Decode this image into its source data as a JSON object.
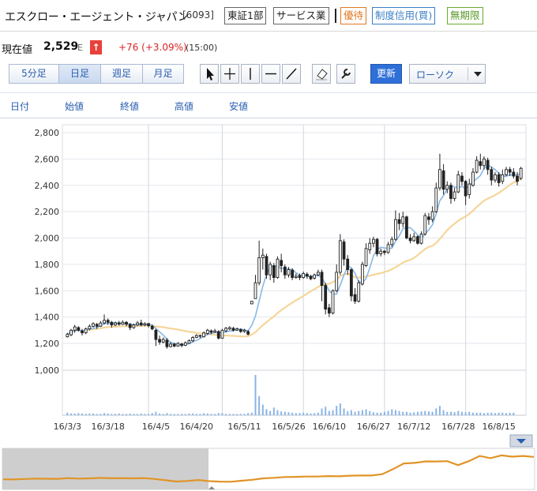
{
  "header": {
    "company_name": "エスクロー・エージェント・ジャパン",
    "code": "[6093]",
    "tags": {
      "market": "東証1部",
      "sector": "サービス業",
      "yutai": "優待",
      "seido": "制度信用(買)",
      "mukigen": "無期限"
    },
    "tag_colors": {
      "yutai": "#e07820",
      "seido": "#3a7fc8",
      "mukigen": "#5a9a2a"
    }
  },
  "quote": {
    "label": "現在値",
    "price": "2,529",
    "flag": "E",
    "arrow": "↑",
    "change": "+76 (+3.09%)",
    "time": "(15:00)",
    "change_color": "#d82424"
  },
  "toolbar": {
    "periods": [
      "5分足",
      "日足",
      "週足",
      "月足"
    ],
    "active_period": "日足",
    "tools": [
      "pointer-icon",
      "crosshair-icon",
      "vertical-line-icon",
      "horizontal-line-icon",
      "trend-line-icon",
      "eraser-icon",
      "wrench-icon"
    ],
    "update_label": "更新",
    "chart_type": "ローソク"
  },
  "ohlc_header": [
    "日付",
    "始値",
    "終値",
    "高値",
    "安値"
  ],
  "chart_data": {
    "type": "candlestick",
    "title": "",
    "ylim": [
      1000,
      2800
    ],
    "yticks": [
      "2,800",
      "2,600",
      "2,400",
      "2,200",
      "2,000",
      "1,800",
      "1,600",
      "1,400",
      "1,200",
      "1,000"
    ],
    "xticks": [
      "16/3/3",
      "16/3/18",
      "16/4/5",
      "16/4/20",
      "16/5/11",
      "16/5/26",
      "16/6/10",
      "16/6/27",
      "16/7/12",
      "16/7/28",
      "16/8/15"
    ],
    "grid": true,
    "volume_panel": true,
    "colors": {
      "ma_short": "#86b8e8",
      "ma_long": "#f5d69a",
      "volume": "#8ab4e6",
      "navigator_line": "#e09428"
    },
    "candles": [
      [
        1250,
        1270,
        1245,
        1280
      ],
      [
        1265,
        1300,
        1255,
        1310
      ],
      [
        1300,
        1325,
        1280,
        1340
      ],
      [
        1320,
        1300,
        1290,
        1330
      ],
      [
        1295,
        1280,
        1260,
        1310
      ],
      [
        1280,
        1310,
        1270,
        1320
      ],
      [
        1310,
        1330,
        1300,
        1345
      ],
      [
        1330,
        1350,
        1320,
        1360
      ],
      [
        1345,
        1330,
        1310,
        1355
      ],
      [
        1330,
        1355,
        1325,
        1370
      ],
      [
        1355,
        1375,
        1345,
        1420
      ],
      [
        1375,
        1360,
        1340,
        1390
      ],
      [
        1360,
        1340,
        1320,
        1370
      ],
      [
        1340,
        1355,
        1330,
        1365
      ],
      [
        1355,
        1345,
        1335,
        1370
      ],
      [
        1345,
        1360,
        1340,
        1375
      ],
      [
        1360,
        1345,
        1330,
        1370
      ],
      [
        1345,
        1320,
        1300,
        1355
      ],
      [
        1320,
        1340,
        1310,
        1350
      ],
      [
        1340,
        1355,
        1330,
        1370
      ],
      [
        1355,
        1340,
        1330,
        1380
      ],
      [
        1340,
        1350,
        1330,
        1360
      ],
      [
        1350,
        1335,
        1320,
        1355
      ],
      [
        1330,
        1310,
        1300,
        1345
      ],
      [
        1300,
        1230,
        1180,
        1310
      ],
      [
        1230,
        1210,
        1190,
        1260
      ],
      [
        1210,
        1230,
        1200,
        1245
      ],
      [
        1225,
        1175,
        1160,
        1240
      ],
      [
        1175,
        1195,
        1170,
        1210
      ],
      [
        1195,
        1180,
        1170,
        1205
      ],
      [
        1180,
        1200,
        1175,
        1210
      ],
      [
        1195,
        1185,
        1170,
        1205
      ],
      [
        1185,
        1205,
        1180,
        1215
      ],
      [
        1200,
        1220,
        1195,
        1230
      ],
      [
        1220,
        1245,
        1210,
        1255
      ],
      [
        1245,
        1260,
        1240,
        1270
      ],
      [
        1260,
        1255,
        1240,
        1265
      ],
      [
        1250,
        1280,
        1245,
        1290
      ],
      [
        1275,
        1300,
        1265,
        1310
      ],
      [
        1295,
        1285,
        1270,
        1305
      ],
      [
        1285,
        1295,
        1280,
        1310
      ],
      [
        1290,
        1240,
        1230,
        1300
      ],
      [
        1240,
        1300,
        1235,
        1310
      ],
      [
        1295,
        1315,
        1285,
        1325
      ],
      [
        1310,
        1320,
        1300,
        1330
      ],
      [
        1315,
        1300,
        1290,
        1325
      ],
      [
        1300,
        1310,
        1295,
        1320
      ],
      [
        1305,
        1290,
        1280,
        1315
      ],
      [
        1290,
        1300,
        1280,
        1310
      ],
      [
        1290,
        1270,
        1260,
        1300
      ],
      [
        1500,
        1520,
        1500,
        1520
      ],
      [
        1540,
        1660,
        1540,
        1720
      ],
      [
        1660,
        1850,
        1640,
        1980
      ],
      [
        1850,
        1870,
        1760,
        1920
      ],
      [
        1860,
        1720,
        1690,
        1880
      ],
      [
        1720,
        1800,
        1680,
        1820
      ],
      [
        1790,
        1700,
        1660,
        1810
      ],
      [
        1700,
        1840,
        1690,
        1860
      ],
      [
        1830,
        1790,
        1740,
        1880
      ],
      [
        1780,
        1720,
        1690,
        1800
      ],
      [
        1720,
        1760,
        1700,
        1780
      ],
      [
        1755,
        1700,
        1680,
        1770
      ],
      [
        1700,
        1710,
        1690,
        1730
      ],
      [
        1715,
        1700,
        1680,
        1730
      ],
      [
        1700,
        1730,
        1690,
        1745
      ],
      [
        1725,
        1710,
        1690,
        1740
      ],
      [
        1710,
        1690,
        1680,
        1720
      ],
      [
        1695,
        1720,
        1685,
        1730
      ],
      [
        1720,
        1740,
        1710,
        1760
      ],
      [
        1740,
        1640,
        1520,
        1760
      ],
      [
        1640,
        1460,
        1420,
        1660
      ],
      [
        1470,
        1430,
        1400,
        1500
      ],
      [
        1430,
        1600,
        1420,
        1610
      ],
      [
        1600,
        1740,
        1590,
        1800
      ],
      [
        1740,
        1980,
        1720,
        2030
      ],
      [
        1970,
        1840,
        1790,
        1990
      ],
      [
        1840,
        1760,
        1720,
        1870
      ],
      [
        1760,
        1560,
        1520,
        1770
      ],
      [
        1570,
        1520,
        1500,
        1620
      ],
      [
        1520,
        1660,
        1510,
        1680
      ],
      [
        1650,
        1800,
        1640,
        1820
      ],
      [
        1790,
        1920,
        1780,
        1960
      ],
      [
        1910,
        1960,
        1880,
        2000
      ],
      [
        1960,
        1990,
        1930,
        2010
      ],
      [
        1990,
        1880,
        1860,
        2000
      ],
      [
        1880,
        1900,
        1860,
        1920
      ],
      [
        1900,
        1890,
        1870,
        1910
      ],
      [
        1890,
        1950,
        1880,
        1970
      ],
      [
        1950,
        1990,
        1930,
        2010
      ],
      [
        1990,
        2140,
        1980,
        2210
      ],
      [
        2140,
        2110,
        2060,
        2190
      ],
      [
        2110,
        2160,
        2080,
        2200
      ],
      [
        2160,
        2000,
        1990,
        2170
      ],
      [
        2000,
        1980,
        1960,
        2030
      ],
      [
        1980,
        2010,
        1970,
        2040
      ],
      [
        2010,
        1960,
        1950,
        2020
      ],
      [
        1960,
        2030,
        1950,
        2050
      ],
      [
        2030,
        2170,
        2020,
        2190
      ],
      [
        2160,
        2140,
        2100,
        2190
      ],
      [
        2140,
        2200,
        2120,
        2240
      ],
      [
        2200,
        2380,
        2190,
        2420
      ],
      [
        2380,
        2520,
        2360,
        2640
      ],
      [
        2510,
        2370,
        2330,
        2560
      ],
      [
        2370,
        2400,
        2340,
        2430
      ],
      [
        2400,
        2300,
        2260,
        2420
      ],
      [
        2300,
        2350,
        2280,
        2380
      ],
      [
        2350,
        2480,
        2340,
        2510
      ],
      [
        2470,
        2430,
        2400,
        2500
      ],
      [
        2430,
        2320,
        2250,
        2440
      ],
      [
        2330,
        2410,
        2300,
        2450
      ],
      [
        2400,
        2500,
        2390,
        2530
      ],
      [
        2500,
        2590,
        2490,
        2620
      ],
      [
        2580,
        2550,
        2520,
        2640
      ],
      [
        2550,
        2600,
        2520,
        2620
      ],
      [
        2590,
        2520,
        2480,
        2610
      ],
      [
        2520,
        2440,
        2400,
        2540
      ],
      [
        2440,
        2480,
        2420,
        2500
      ],
      [
        2480,
        2420,
        2390,
        2500
      ],
      [
        2430,
        2480,
        2410,
        2520
      ],
      [
        2480,
        2520,
        2470,
        2540
      ],
      [
        2520,
        2500,
        2470,
        2540
      ],
      [
        2500,
        2470,
        2450,
        2530
      ],
      [
        2470,
        2430,
        2400,
        2500
      ],
      [
        2453,
        2529,
        2440,
        2540
      ]
    ],
    "volume": [
      6,
      4,
      4,
      5,
      4,
      3,
      4,
      4,
      3,
      3,
      5,
      4,
      3,
      3,
      4,
      3,
      3,
      4,
      3,
      3,
      4,
      3,
      3,
      5,
      8,
      4,
      3,
      5,
      3,
      3,
      3,
      3,
      3,
      4,
      4,
      3,
      3,
      5,
      4,
      3,
      3,
      5,
      5,
      3,
      3,
      3,
      3,
      3,
      3,
      5,
      6,
      95,
      45,
      25,
      14,
      10,
      18,
      12,
      9,
      8,
      7,
      6,
      5,
      5,
      6,
      5,
      4,
      5,
      6,
      16,
      20,
      10,
      12,
      22,
      28,
      16,
      9,
      12,
      8,
      10,
      12,
      14,
      10,
      7,
      6,
      6,
      8,
      10,
      14,
      12,
      10,
      8,
      8,
      6,
      7,
      8,
      9,
      10,
      9,
      8,
      16,
      22,
      12,
      8,
      8,
      7,
      10,
      8,
      7,
      8,
      6,
      6,
      6,
      5,
      6,
      6,
      5,
      6,
      6,
      5,
      6,
      6
    ]
  },
  "navigator": {
    "series": [
      1220,
      1218,
      1225,
      1232,
      1230,
      1228,
      1240,
      1232,
      1236,
      1244,
      1238,
      1240,
      1236,
      1240,
      1226,
      1204,
      1182,
      1192,
      1208,
      1188,
      1180,
      1178,
      1195,
      1212,
      1236,
      1246,
      1260,
      1262,
      1268,
      1268,
      1276,
      1272,
      1283,
      1286,
      1286,
      1309,
      1396,
      1494,
      1503,
      1529,
      1528,
      1534,
      1466,
      1534,
      1623,
      1586,
      1633,
      1611,
      1624,
      1607
    ]
  }
}
